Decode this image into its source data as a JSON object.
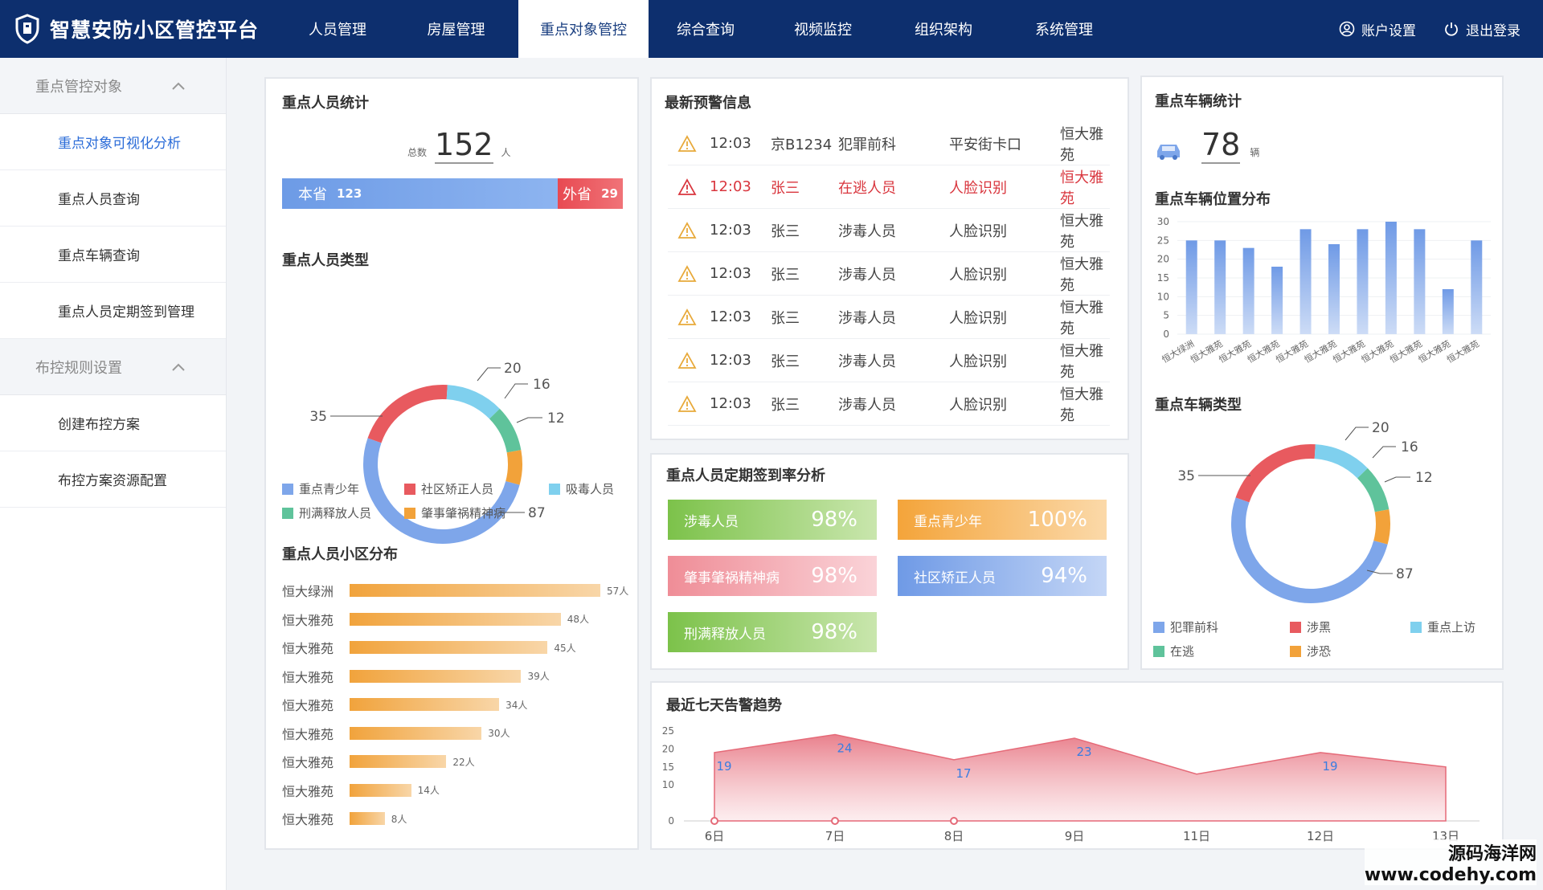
{
  "app": {
    "title": "智慧安防小区管控平台"
  },
  "nav": [
    {
      "label": "人员管理"
    },
    {
      "label": "房屋管理"
    },
    {
      "label": "重点对象管控"
    },
    {
      "label": "综合查询"
    },
    {
      "label": "视频监控"
    },
    {
      "label": "组织架构"
    },
    {
      "label": "系统管理"
    }
  ],
  "user": {
    "account": "账户设置",
    "logout": "退出登录"
  },
  "sidebar": {
    "group1": "重点管控对象",
    "items1": [
      "重点对象可视化分析",
      "重点人员查询",
      "重点车辆查询",
      "重点人员定期签到管理"
    ],
    "group2": "布控规则设置",
    "items2": [
      "创建布控方案",
      "布控方案资源配置"
    ]
  },
  "persons": {
    "title": "重点人员统计",
    "total_label": "总数",
    "total": "152",
    "unit": "人",
    "local_label": "本省",
    "local": "123",
    "other_label": "外省",
    "other": "29"
  },
  "person_types": {
    "title": "重点人员类型",
    "labels": {
      "a": "20",
      "b": "16",
      "c": "12",
      "d": "35",
      "e": "87"
    },
    "legend": [
      "重点青少年",
      "社区矫正人员",
      "吸毒人员",
      "刑满释放人员",
      "肇事肇祸精神病"
    ],
    "colors": [
      "#7ea6ea",
      "#e85a5f",
      "#7fd0ee",
      "#5fc39b",
      "#f2a23a"
    ]
  },
  "community": {
    "title": "重点人员小区分布",
    "rows": [
      {
        "name": "恒大绿洲",
        "value": 57,
        "label": "57人"
      },
      {
        "name": "恒大雅苑",
        "value": 48,
        "label": "48人"
      },
      {
        "name": "恒大雅苑",
        "value": 45,
        "label": "45人"
      },
      {
        "name": "恒大雅苑",
        "value": 39,
        "label": "39人"
      },
      {
        "name": "恒大雅苑",
        "value": 34,
        "label": "34人"
      },
      {
        "name": "恒大雅苑",
        "value": 30,
        "label": "30人"
      },
      {
        "name": "恒大雅苑",
        "value": 22,
        "label": "22人"
      },
      {
        "name": "恒大雅苑",
        "value": 14,
        "label": "14人"
      },
      {
        "name": "恒大雅苑",
        "value": 8,
        "label": "8人"
      }
    ],
    "max": 57
  },
  "alerts": {
    "title": "最新预警信息",
    "rows": [
      {
        "time": "12:03",
        "who": "京B1234",
        "type": "犯罪前科",
        "src": "平安街卡口",
        "place": "恒大雅苑",
        "hot": false
      },
      {
        "time": "12:03",
        "who": "张三",
        "type": "在逃人员",
        "src": "人脸识别",
        "place": "恒大雅苑",
        "hot": true
      },
      {
        "time": "12:03",
        "who": "张三",
        "type": "涉毒人员",
        "src": "人脸识别",
        "place": "恒大雅苑",
        "hot": false
      },
      {
        "time": "12:03",
        "who": "张三",
        "type": "涉毒人员",
        "src": "人脸识别",
        "place": "恒大雅苑",
        "hot": false
      },
      {
        "time": "12:03",
        "who": "张三",
        "type": "涉毒人员",
        "src": "人脸识别",
        "place": "恒大雅苑",
        "hot": false
      },
      {
        "time": "12:03",
        "who": "张三",
        "type": "涉毒人员",
        "src": "人脸识别",
        "place": "恒大雅苑",
        "hot": false
      },
      {
        "time": "12:03",
        "who": "张三",
        "type": "涉毒人员",
        "src": "人脸识别",
        "place": "恒大雅苑",
        "hot": false
      }
    ]
  },
  "signin": {
    "title": "重点人员定期签到率分析",
    "items": [
      {
        "label": "涉毒人员",
        "value": "98%",
        "from": "#7cc24a",
        "to": "#c9e6ad"
      },
      {
        "label": "重点青少年",
        "value": "100%",
        "from": "#f4a43a",
        "to": "#fbd9a9"
      },
      {
        "label": "肇事肇祸精神病",
        "value": "98%",
        "from": "#ef8d97",
        "to": "#fad3d8"
      },
      {
        "label": "社区矫正人员",
        "value": "94%",
        "from": "#6f9ae6",
        "to": "#c4d6f6"
      },
      {
        "label": "刑满释放人员",
        "value": "98%",
        "from": "#7cc24a",
        "to": "#c9e6ad"
      }
    ]
  },
  "vehicles": {
    "title": "重点车辆统计",
    "total": "78",
    "unit": "辆",
    "dist_title": "重点车辆位置分布",
    "type_title": "重点车辆类型",
    "type_labels": {
      "a": "20",
      "b": "16",
      "c": "12",
      "d": "35",
      "e": "87"
    },
    "legend": [
      "犯罪前科",
      "涉黑",
      "重点上访",
      "在逃",
      "涉恐"
    ]
  },
  "trend": {
    "title": "最近七天告警趋势"
  },
  "watermark": {
    "line1": "源码海洋网",
    "line2": "www.codehy.com"
  },
  "chart_data": [
    {
      "type": "bar",
      "title": "重点车辆位置分布",
      "categories": [
        "恒大绿洲",
        "恒大雅苑",
        "恒大雅苑",
        "恒大雅苑",
        "恒大雅苑",
        "恒大雅苑",
        "恒大雅苑",
        "恒大雅苑",
        "恒大雅苑",
        "恒大雅苑",
        "恒大雅苑"
      ],
      "values": [
        25,
        25,
        23,
        18,
        28,
        24,
        28,
        30,
        28,
        12,
        25
      ],
      "ylim": [
        0,
        30
      ],
      "yticks": [
        "0",
        "5",
        "10",
        "15",
        "20",
        "25",
        "30"
      ]
    },
    {
      "type": "area",
      "title": "最近七天告警趋势",
      "categories": [
        "6日",
        "7日",
        "8日",
        "9日",
        "11日",
        "12日",
        "13日"
      ],
      "values": [
        19,
        24,
        17,
        23,
        13,
        19,
        15
      ],
      "labels": [
        "19",
        "24",
        "17",
        "23",
        "",
        "19",
        ""
      ],
      "ylim": [
        0,
        25
      ],
      "yticks": [
        "0",
        "10",
        "15",
        "20",
        "25"
      ]
    },
    {
      "type": "pie",
      "title": "重点人员类型",
      "values": [
        87,
        35,
        20,
        16,
        12
      ]
    },
    {
      "type": "pie",
      "title": "重点车辆类型",
      "values": [
        87,
        35,
        20,
        16,
        12
      ]
    }
  ]
}
